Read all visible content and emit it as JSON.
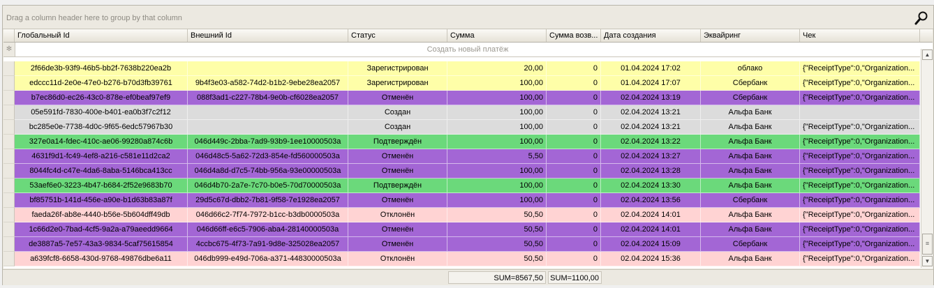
{
  "group_panel": {
    "hint": "Drag a column header here to group by that column",
    "search_icon": "magnifier-icon"
  },
  "columns": [
    "Глобальный Id",
    "Внешний Id",
    "Статус",
    "Сумма",
    "Сумма возв...",
    "Дата создания",
    "Эквайринг",
    "Чек"
  ],
  "new_row": {
    "indicator": "✻",
    "label": "Создать новый платёж"
  },
  "colors": {
    "yellow": "#fefea8",
    "purple": "#a366d5",
    "gray": "#dcdcdc",
    "green": "#6bd97b",
    "pink": "#ffd3d3"
  },
  "rows": [
    {
      "c": [
        "2f66de3b-93f9-46b5-bb2f-7638b220ea2b",
        "",
        "Зарегистрирован",
        "20,00",
        "0",
        "01.04.2024 17:02",
        "облако",
        "{\"ReceiptType\":0,\"Organization..."
      ],
      "color": "#fefea8"
    },
    {
      "c": [
        "edccc11d-2e0e-47e0-b276-b70d3fb39761",
        "9b4f3e03-a582-74d2-b1b2-9ebe28ea2057",
        "Зарегистрирован",
        "100,00",
        "0",
        "01.04.2024 17:07",
        "Сбербанк",
        "{\"ReceiptType\":0,\"Organization..."
      ],
      "color": "#fefea8"
    },
    {
      "c": [
        "b7ec86d0-ec26-43c0-878e-ef0beaf97ef9",
        "088f3ad1-c227-78b4-9e0b-cf6028ea2057",
        "Отменён",
        "100,00",
        "0",
        "02.04.2024 13:19",
        "Сбербанк",
        "{\"ReceiptType\":0,\"Organization..."
      ],
      "color": "#a366d5"
    },
    {
      "c": [
        "05e591fd-7830-400e-b401-ea0b3f7c2f12",
        "",
        "Создан",
        "100,00",
        "0",
        "02.04.2024 13:21",
        "Альфа Банк",
        ""
      ],
      "color": "#dcdcdc"
    },
    {
      "c": [
        "bc285e0e-7738-4d0c-9f65-6edc57967b30",
        "",
        "Создан",
        "100,00",
        "0",
        "02.04.2024 13:21",
        "Альфа Банк",
        "{\"ReceiptType\":0,\"Organization..."
      ],
      "color": "#dcdcdc"
    },
    {
      "c": [
        "327e0a14-fdec-410c-ae06-99280a874c6b",
        "046d449c-2bba-7ad9-93b9-1ee10000503a",
        "Подтверждён",
        "100,00",
        "0",
        "02.04.2024 13:22",
        "Альфа Банк",
        "{\"ReceiptType\":0,\"Organization..."
      ],
      "color": "#6bd97b"
    },
    {
      "c": [
        "4631f9d1-fc49-4ef8-a216-c581e11d2ca2",
        "046d48c5-5a62-72d3-854e-fd560000503a",
        "Отменён",
        "5,50",
        "0",
        "02.04.2024 13:27",
        "Альфа Банк",
        "{\"ReceiptType\":0,\"Organization..."
      ],
      "color": "#a366d5"
    },
    {
      "c": [
        "8044fc4d-c47e-4da6-8aba-5146bca413cc",
        "046d4a8d-d7c5-74bb-956a-93e00000503a",
        "Отменён",
        "100,00",
        "0",
        "02.04.2024 13:28",
        "Альфа Банк",
        "{\"ReceiptType\":0,\"Organization..."
      ],
      "color": "#a366d5"
    },
    {
      "c": [
        "53aef6e0-3223-4b47-b684-2f52e9683b70",
        "046d4b70-2a7e-7c70-b0e5-70d70000503a",
        "Подтверждён",
        "100,00",
        "0",
        "02.04.2024 13:30",
        "Альфа Банк",
        "{\"ReceiptType\":0,\"Organization..."
      ],
      "color": "#6bd97b"
    },
    {
      "c": [
        "bf85751b-141d-456e-a90e-b1d63b83a87f",
        "29d5c67d-dbb2-7b81-9f58-7e1928ea2057",
        "Отменён",
        "100,00",
        "0",
        "02.04.2024 13:56",
        "Сбербанк",
        "{\"ReceiptType\":0,\"Organization..."
      ],
      "color": "#a366d5"
    },
    {
      "c": [
        "faeda26f-ab8e-4440-b56e-5b604dff49db",
        "046d66c2-7f74-7972-b1cc-b3db0000503a",
        "Отклонён",
        "50,50",
        "0",
        "02.04.2024 14:01",
        "Альфа Банк",
        "{\"ReceiptType\":0,\"Organization..."
      ],
      "color": "#ffd3d3"
    },
    {
      "c": [
        "1c66d2e0-7bad-4cf5-9a2a-a79aeedd9664",
        "046d66ff-e6c5-7906-aba4-28140000503a",
        "Отменён",
        "50,50",
        "0",
        "02.04.2024 14:01",
        "Альфа Банк",
        "{\"ReceiptType\":0,\"Organization..."
      ],
      "color": "#a366d5"
    },
    {
      "c": [
        "de3887a5-7e57-43a3-9834-5caf75615854",
        "4ccbc675-4f73-7a91-9d8e-325028ea2057",
        "Отменён",
        "50,50",
        "0",
        "02.04.2024 15:09",
        "Сбербанк",
        "{\"ReceiptType\":0,\"Organization..."
      ],
      "color": "#a366d5"
    },
    {
      "c": [
        "a639fcf8-6658-430d-9768-49876dbe6a11",
        "046db999-e49d-706a-a371-44830000503a",
        "Отклонён",
        "50,50",
        "0",
        "02.04.2024 15:36",
        "Альфа Банк",
        "{\"ReceiptType\":0,\"Organization..."
      ],
      "color": "#ffd3d3"
    }
  ],
  "footer": {
    "sum_amount": "SUM=8567,50",
    "sum_refund": "SUM=1100,00"
  },
  "scrollbar": {
    "up_icon": "▲",
    "down_icon": "▼",
    "thumb_grip": "≡"
  }
}
